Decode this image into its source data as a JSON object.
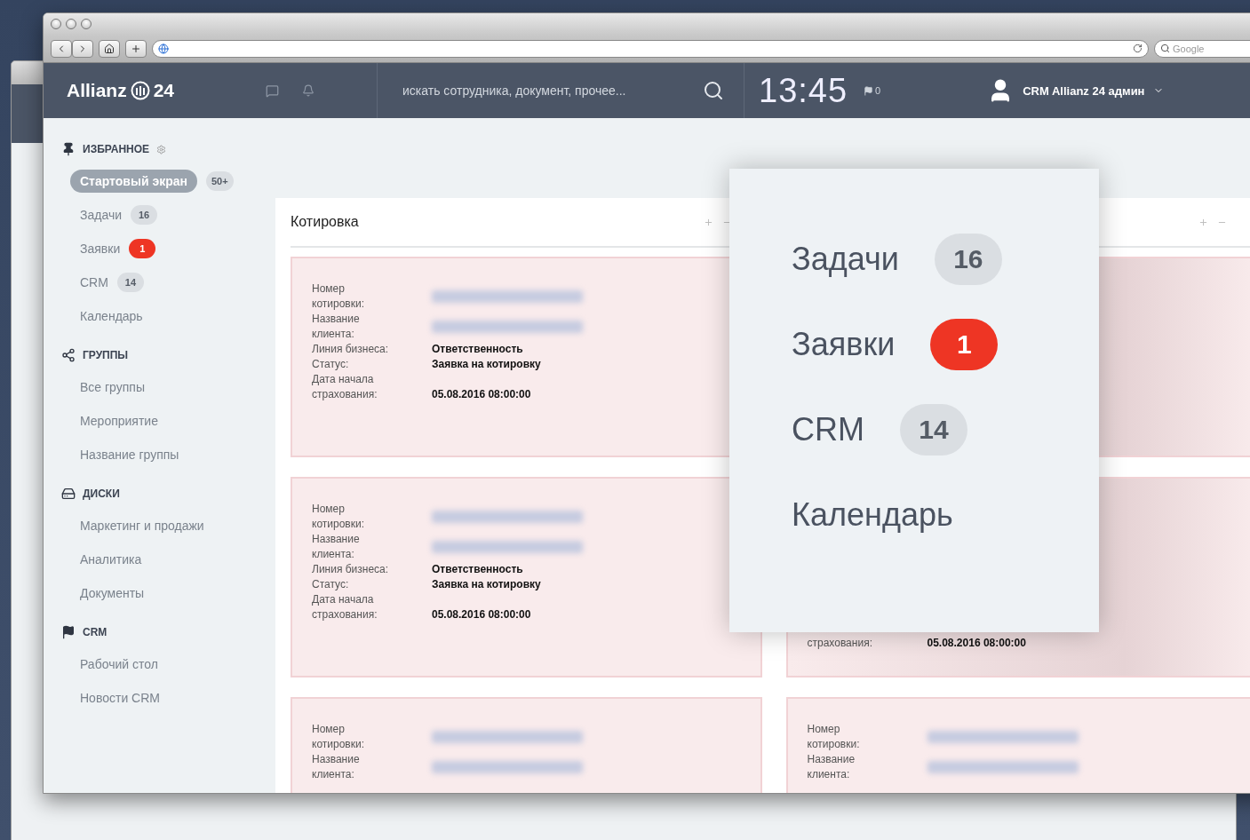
{
  "browser": {
    "search_placeholder": "Google"
  },
  "header": {
    "logo": "Allianz",
    "logo_suffix": "24",
    "search_placeholder": "искать сотрудника, документ, прочее...",
    "time": "13:45",
    "flag_count": "0",
    "user": "CRM Allianz 24 админ"
  },
  "sidebar": {
    "sections": [
      {
        "kind": "pin",
        "title": "ИЗБРАННОЕ",
        "items": [
          {
            "label": "Стартовый экран",
            "selected": true,
            "badge": "50+",
            "badge_alert": false
          },
          {
            "label": "Задачи",
            "selected": false,
            "badge": "16",
            "badge_alert": false
          },
          {
            "label": "Заявки",
            "selected": false,
            "badge": "1",
            "badge_alert": true
          },
          {
            "label": "CRM",
            "selected": false,
            "badge": "14",
            "badge_alert": false
          },
          {
            "label": "Календарь",
            "selected": false
          }
        ]
      },
      {
        "kind": "share",
        "title": "ГРУППЫ",
        "items": [
          {
            "label": "Все группы",
            "selected": false
          },
          {
            "label": "Мероприятие",
            "selected": false
          },
          {
            "label": "Название группы",
            "selected": false
          }
        ]
      },
      {
        "kind": "disk",
        "title": "ДИСКИ",
        "items": [
          {
            "label": "Маркетинг и продажи",
            "selected": false
          },
          {
            "label": "Аналитика",
            "selected": false
          },
          {
            "label": "Документы",
            "selected": false
          }
        ]
      },
      {
        "kind": "flag",
        "title": "CRM",
        "items": [
          {
            "label": "Рабочий стол",
            "selected": false
          },
          {
            "label": "Новости CRM",
            "selected": false
          }
        ]
      }
    ]
  },
  "widgets": [
    {
      "title": "Котировка",
      "cards": [
        {
          "covered": false,
          "fields": [
            {
              "label": "Номер котировки:",
              "kind": "blurred"
            },
            {
              "label": "Название клиента:",
              "kind": "blurred"
            },
            {
              "label": "Линия бизнеса:",
              "kind": "text",
              "value": "Ответственность"
            },
            {
              "label": "Статус:",
              "kind": "text",
              "value": "Заявка на котировку"
            },
            {
              "label": "Дата начала страхования:",
              "kind": "text",
              "value": "05.08.2016 08:00:00"
            }
          ]
        },
        {
          "covered": false,
          "fields": [
            {
              "label": "Номер котировки:",
              "kind": "blurred"
            },
            {
              "label": "Название клиента:",
              "kind": "blurred"
            },
            {
              "label": "Линия бизнеса:",
              "kind": "text",
              "value": "Ответственность"
            },
            {
              "label": "Статус:",
              "kind": "text",
              "value": "Заявка на котировку"
            },
            {
              "label": "Дата начала страхования:",
              "kind": "text",
              "value": "05.08.2016 08:00:00"
            }
          ]
        },
        {
          "covered": false,
          "fields": [
            {
              "label": "Номер котировки:",
              "kind": "blurred"
            },
            {
              "label": "Название клиента:",
              "kind": "blurred"
            }
          ]
        }
      ]
    },
    {
      "cards": [
        {
          "covered": true
        },
        {
          "covered": true,
          "fields": [
            {
              "label": "страхования:",
              "kind": "text",
              "value": "05.08.2016 08:00:00"
            }
          ]
        },
        {
          "covered": false,
          "fields": [
            {
              "label": "Номер котировки:",
              "kind": "blurred"
            },
            {
              "label": "Название клиента:",
              "kind": "blurred"
            }
          ]
        }
      ]
    }
  ],
  "popup": {
    "items": [
      {
        "label": "Задачи",
        "badge": "16",
        "badge_alert": false
      },
      {
        "label": "Заявки",
        "badge": "1",
        "badge_alert": true
      },
      {
        "label": "CRM",
        "badge": "14",
        "badge_alert": false
      },
      {
        "label": "Календарь"
      }
    ]
  }
}
